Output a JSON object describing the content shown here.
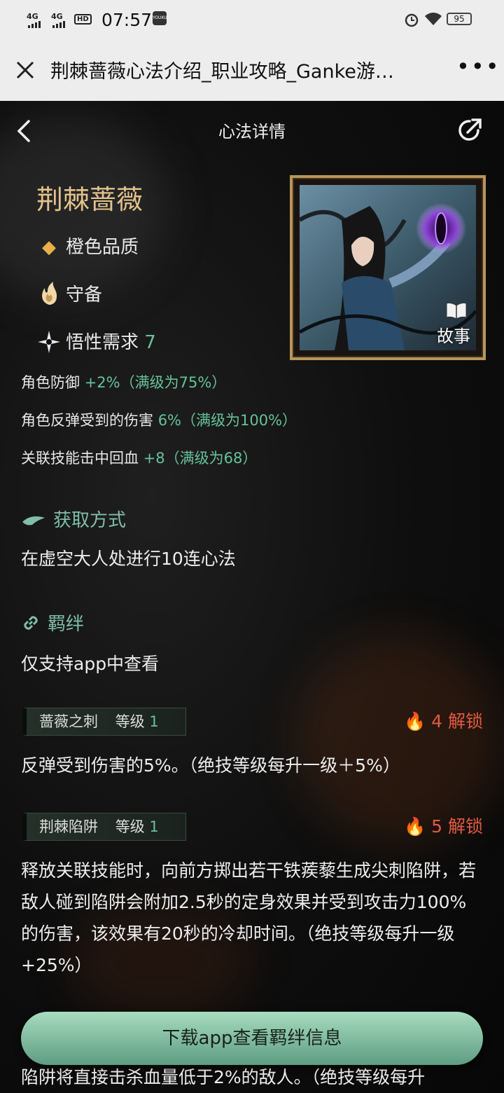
{
  "status_bar": {
    "signal1": "4G",
    "signal2": "4G",
    "hd": "HD",
    "time": "07:57",
    "app_badge": "YOUKU",
    "battery": "95"
  },
  "browser": {
    "title": "荆棘蔷薇心法介绍_职业攻略_Ganke游…",
    "more": "•••"
  },
  "header": {
    "title": "心法详情"
  },
  "heart": {
    "name": "荆棘蔷薇",
    "quality": "橙色品质",
    "type": "守备",
    "comprehension_label": "悟性需求",
    "comprehension_value": "7",
    "story_label": "故事"
  },
  "stats": [
    {
      "label": "角色防御 ",
      "value": "+2%（满级为75%）"
    },
    {
      "label": "角色反弹受到的伤害 ",
      "value": "6%（满级为100%）"
    },
    {
      "label": "关联技能击中回血 ",
      "value": "+8（满级为68）"
    }
  ],
  "acquire": {
    "heading": "获取方式",
    "text": "在虚空大人处进行10连心法"
  },
  "bond": {
    "heading": "羁绊",
    "text": "仅支持app中查看"
  },
  "skills": [
    {
      "name": "蔷薇之刺",
      "level_label": "等级",
      "level": "1",
      "unlock": "4 解锁",
      "desc": "反弹受到伤害的5%。（绝技等级每升一级＋5%）"
    },
    {
      "name": "荆棘陷阱",
      "level_label": "等级",
      "level": "1",
      "unlock": "5 解锁",
      "desc": "释放关联技能时，向前方掷出若干铁蒺藜生成尖刺陷阱，若敌人碰到陷阱会附加2.5秒的定身效果并受到攻击力100%的伤害，该效果有20秒的冷却时间。（绝技等级每升一级+25%）"
    }
  ],
  "partial_text": "陷阱将直接击杀血量低于2%的敌人。（绝技等级每升",
  "download_button": "下载app查看羁绊信息",
  "colors": {
    "gold": "#e2c28c",
    "green": "#66c29a",
    "red": "#e25a42",
    "button": "#8ccaa8"
  }
}
